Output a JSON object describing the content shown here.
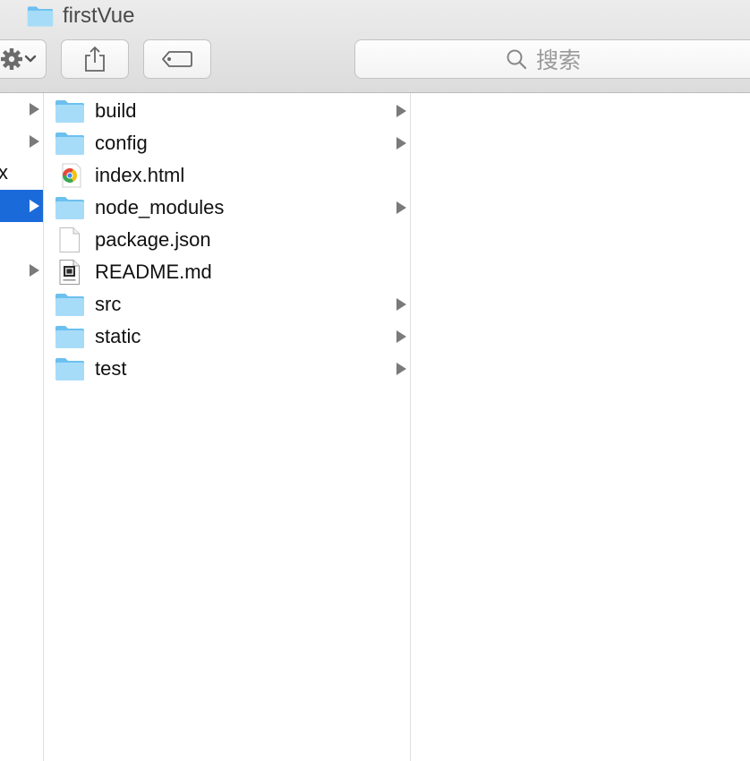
{
  "window": {
    "title": "firstVue"
  },
  "toolbar": {
    "action_icon": "gear-icon",
    "share_icon": "share-icon",
    "tag_icon": "tag-icon",
    "search_placeholder": "搜索"
  },
  "sidebar_column": {
    "rows": [
      {
        "label": "",
        "has_arrow": true,
        "selected": false
      },
      {
        "label": "",
        "has_arrow": true,
        "selected": false
      },
      {
        "label": "x",
        "has_arrow": false,
        "selected": false
      },
      {
        "label": "",
        "has_arrow": true,
        "selected": true
      },
      {
        "label": "",
        "has_arrow": false,
        "selected": false
      },
      {
        "label": "",
        "has_arrow": true,
        "selected": false
      }
    ]
  },
  "files": [
    {
      "name": "build",
      "icon": "folder-icon",
      "has_children": true
    },
    {
      "name": "config",
      "icon": "folder-icon",
      "has_children": true
    },
    {
      "name": "index.html",
      "icon": "chrome-html-icon",
      "has_children": false
    },
    {
      "name": "node_modules",
      "icon": "folder-icon",
      "has_children": true
    },
    {
      "name": "package.json",
      "icon": "blank-document-icon",
      "has_children": false
    },
    {
      "name": "README.md",
      "icon": "markdown-document-icon",
      "has_children": false
    },
    {
      "name": "src",
      "icon": "folder-icon",
      "has_children": true
    },
    {
      "name": "static",
      "icon": "folder-icon",
      "has_children": true
    },
    {
      "name": "test",
      "icon": "folder-icon",
      "has_children": true
    }
  ],
  "colors": {
    "selection": "#1b6ad9",
    "folder_light": "#a7dcf8",
    "folder_dark": "#6cc0ef"
  }
}
